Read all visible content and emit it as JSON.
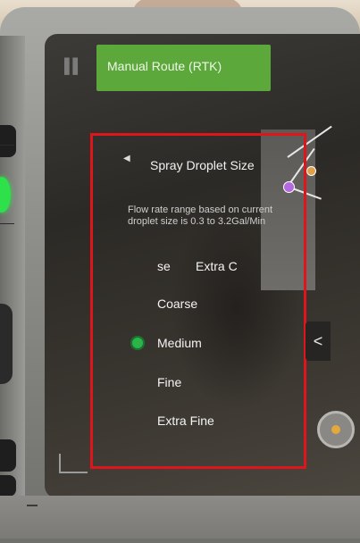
{
  "header": {
    "route_mode": "Manual Route (RTK)"
  },
  "panel": {
    "title": "Spray Droplet Size",
    "info": "Flow rate range based on current droplet size is 0.3 to 3.2Gal/Min",
    "options": {
      "partial_left": "se",
      "partial_right": "Extra Coarse",
      "coarse": "Coarse",
      "medium": "Medium",
      "fine": "Fine",
      "extra_fine": "Extra Fine"
    },
    "selected": "Medium"
  },
  "controls": {
    "collapse_glyph": "<",
    "back_glyph": "◀"
  },
  "colors": {
    "accent_green": "#5ca83a",
    "selected_radio": "#2ab44a",
    "highlight_box": "#e0141b"
  },
  "icons": [
    "pause-icon",
    "back-icon",
    "chevron-left-icon",
    "camera-button-icon"
  ]
}
